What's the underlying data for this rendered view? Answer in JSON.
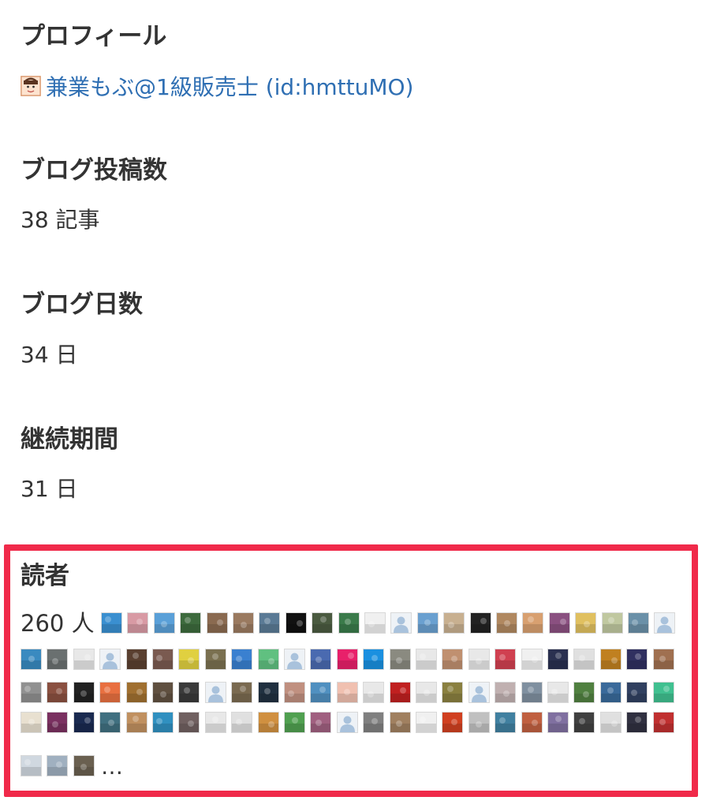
{
  "profile": {
    "heading": "プロフィール",
    "user_link": "兼業もぶ@1級販売士 (id:hmttuMO)",
    "avatar_icon": "user-avatar-icon"
  },
  "posts": {
    "heading": "ブログ投稿数",
    "value": "38 記事"
  },
  "days": {
    "heading": "ブログ日数",
    "value": "34 日"
  },
  "period": {
    "heading": "継続期間",
    "value": "31 日"
  },
  "readers": {
    "heading": "読者",
    "count": "260 人",
    "more": "…",
    "highlight_color": "#f02a4a",
    "icon_colors": [
      [
        "#3a8fd0",
        "#d89aa4",
        "#5aa0d8",
        "#3d6a3d",
        "#8a6a50",
        "#9a7a60",
        "#5a7a95",
        "#111111",
        "#4a5a40",
        "#3a7a4a",
        "#f0f0f0",
        "#a9c2dc",
        "#6aa0d0",
        "#c8b090",
        "#222222",
        "#b08860",
        "#d8a070",
        "#8a5080",
        "#e0c060",
        "#c0c8a0",
        "#6a90a8",
        "#a9c2dc"
      ],
      [
        "#3a8ac0",
        "#6a7070",
        "#e8e8e8",
        "#a9c2dc",
        "#5a4030",
        "#7a5a50",
        "#e0d040",
        "#7a7050",
        "#3a80d0",
        "#60c080",
        "#a9c2dc",
        "#4a6ab0",
        "#e8206a",
        "#1a90e0",
        "#8a8a80",
        "#e8e8e8",
        "#c09070",
        "#e8e8e8",
        "#d04050",
        "#f0f0f0",
        "#2a3050",
        "#e0e0e0",
        "#c08020",
        "#303060",
        "#a07050"
      ],
      [
        "#909090",
        "#8a5040",
        "#222222",
        "#e87040",
        "#a07030",
        "#605040",
        "#3a3a3a",
        "#a9c2dc",
        "#7a6a50",
        "#203040",
        "#c09080",
        "#5090c0",
        "#f0c0b0",
        "#e8e8e8",
        "#c02020",
        "#e8e8e8",
        "#8a8040",
        "#a9c2dc",
        "#c0b0b0",
        "#8090a0",
        "#e8e8e8",
        "#508040",
        "#3a6a9a",
        "#304060",
        "#40c090"
      ],
      [
        "#e8e0d0",
        "#7a3060",
        "#1a2a50",
        "#407080",
        "#c09060",
        "#3090c0",
        "#706060",
        "#e8e8e8",
        "#e0e0e0",
        "#d09040",
        "#50a050",
        "#a06080",
        "#a9c2dc",
        "#808080",
        "#a08060",
        "#f0f0f0",
        "#d04020",
        "#c0c0c0",
        "#4080a0",
        "#c06040",
        "#8070a0",
        "#404040",
        "#e0e0e0",
        "#303040",
        "#c03030"
      ],
      [
        "#d0d8e0",
        "#a0b0c0",
        "#6a6050"
      ]
    ]
  }
}
